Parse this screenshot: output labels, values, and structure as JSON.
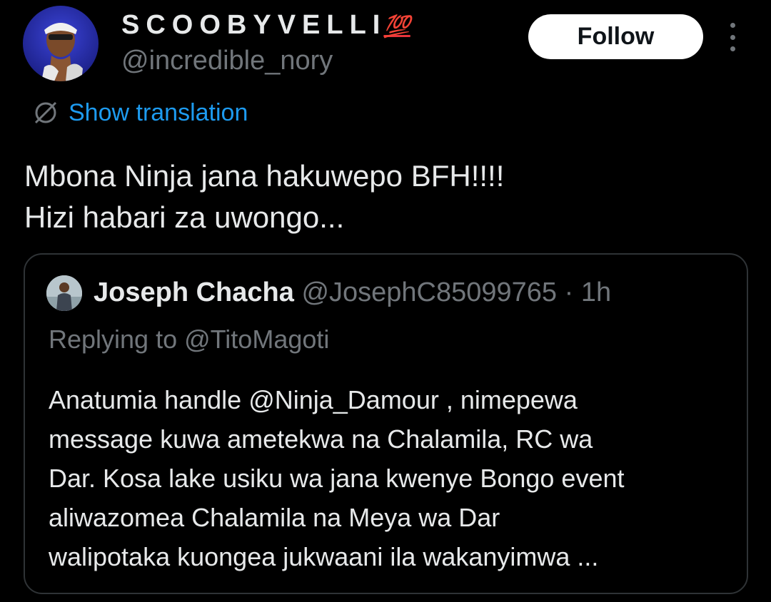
{
  "author": {
    "display_name": "SCOOBYVELLI",
    "badge_emoji": "💯",
    "handle": "@incredible_nory",
    "avatar_icon": "profile-avatar"
  },
  "actions": {
    "follow_label": "Follow",
    "more_icon": "more-vertical-icon"
  },
  "translation": {
    "label": "Show translation",
    "icon": "translate-icon"
  },
  "tweet": {
    "line1": "Mbona Ninja jana hakuwepo BFH!!!!",
    "line2": "Hizi habari za uwongo..."
  },
  "quoted_tweet": {
    "author_name": "Joseph Chacha",
    "author_handle": "@JosephC85099765",
    "separator": " · ",
    "time": "1h",
    "replying_to": "Replying to @TitoMagoti",
    "lines": [
      "Anatumia handle @Ninja_Damour , nimepewa",
      "message kuwa ametekwa na Chalamila, RC wa",
      "Dar. Kosa lake usiku wa jana kwenye Bongo event",
      "aliwazomea Chalamila na Meya wa Dar",
      "walipotaka kuongea jukwaani ila wakanyimwa ..."
    ]
  },
  "colors": {
    "background": "#000000",
    "text_primary": "#e7e9ea",
    "text_secondary": "#71767b",
    "link": "#1d9bf0",
    "follow_bg": "#ffffff",
    "border": "#2f3336",
    "badge": "#e8343b"
  }
}
